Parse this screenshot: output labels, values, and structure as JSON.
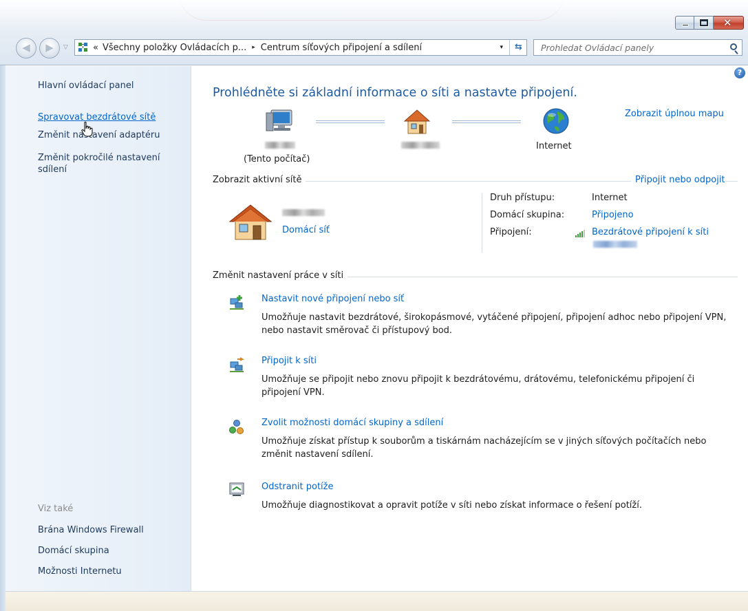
{
  "window": {
    "min_glyph": "",
    "max_glyph": "",
    "close_glyph": "✕"
  },
  "address_bar": {
    "overflow": "«",
    "crumbs": [
      "Všechny položky Ovládacích p...",
      "Centrum síťových připojení a sdílení"
    ],
    "separator": "▸",
    "dropdown": "▾",
    "refresh": "⇆"
  },
  "search": {
    "placeholder": "Prohledat Ovládací panely"
  },
  "sidebar": {
    "items": [
      {
        "label": "Hlavní ovládací panel"
      },
      {
        "label": "Spravovat bezdrátové sítě"
      },
      {
        "label": "Změnit nastavení adaptéru"
      },
      {
        "label": "Změnit pokročilé nastavení\nsdílení"
      }
    ],
    "see_also": {
      "heading": "Viz také",
      "items": [
        {
          "label": "Brána Windows Firewall"
        },
        {
          "label": "Domácí skupina"
        },
        {
          "label": "Možnosti Internetu"
        }
      ]
    }
  },
  "main": {
    "heading": "Prohlédněte si základní informace o síti a nastavte připojení.",
    "full_map_link": "Zobrazit úplnou mapu",
    "map": {
      "computer_caption": "(Tento počítač)",
      "internet_label": "Internet"
    },
    "active_networks": {
      "title": "Zobrazit aktivní sítě",
      "connect_link": "Připojit nebo odpojit",
      "network_type": "Domácí síť",
      "props": [
        {
          "label": "Druh přístupu:",
          "value": "Internet",
          "is_link": false
        },
        {
          "label": "Domácí skupina:",
          "value": "Připojeno",
          "is_link": true
        },
        {
          "label": "Připojení:",
          "value": "Bezdrátové připojení k síti",
          "is_link": true
        }
      ]
    },
    "change_settings": {
      "title": "Změnit nastavení práce v síti",
      "tasks": [
        {
          "title": "Nastavit nové připojení nebo síť",
          "desc": "Umožňuje nastavit bezdrátové, širokopásmové, vytáčené připojení, připojení adhoc nebo připojení VPN, nebo nastavit směrovač či přístupový bod."
        },
        {
          "title": "Připojit k síti",
          "desc": "Umožňuje se připojit nebo znovu připojit k bezdrátovému, drátovému, telefonickému připojení či připojení VPN."
        },
        {
          "title": "Zvolit možnosti domácí skupiny a sdílení",
          "desc": "Umožňuje získat přístup k souborům a tiskárnám nacházejícím se v jiných síťových počítačích nebo změnit nastavení sdílení."
        },
        {
          "title": "Odstranit potíže",
          "desc": "Umožňuje diagnostikovat a opravit potíže v síti nebo získat informace o řešení potíží."
        }
      ]
    },
    "help_glyph": "?"
  },
  "icons": {
    "back": "back-arrow-icon",
    "forward": "forward-arrow-icon",
    "computer": "computer-icon",
    "router_house": "home-network-icon",
    "internet": "globe-icon",
    "home_network": "house-icon",
    "signal": "wireless-signal-icon",
    "task_new_connection": "new-connection-icon",
    "task_connect": "connect-network-icon",
    "task_homegroup": "homegroup-icon",
    "task_troubleshoot": "troubleshoot-icon",
    "help": "help-icon"
  },
  "colors": {
    "link": "#0066cc",
    "heading": "#1e5aa0",
    "sidebar_text": "#1e395b",
    "sidebar_bg": "#e8f0f8",
    "close_button": "#c84430"
  }
}
